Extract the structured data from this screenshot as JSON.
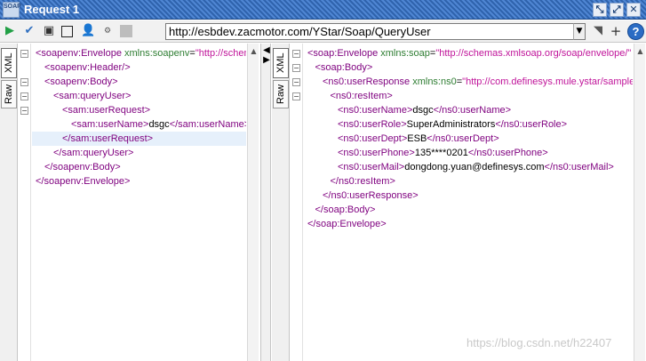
{
  "window": {
    "icon_text": "SOAP",
    "title": "Request 1",
    "buttons": [
      "minimize-restore",
      "maximize",
      "close"
    ]
  },
  "toolbar": {
    "icons": [
      "submit-request-icon",
      "validate-icon",
      "format-icon",
      "stop-icon",
      "user-icon",
      "wsdl-icon",
      "disabled-square-icon"
    ],
    "url": "http://esbdev.zacmotor.com/YStar/Soap/QueryUser",
    "dropdown_glyph": "▼",
    "help_label": "?"
  },
  "request": {
    "tabs": [
      "XML",
      "Raw"
    ],
    "active_tab": "XML",
    "lines": [
      {
        "indent": 0,
        "fold": "−",
        "parts": [
          [
            "t",
            "<soapenv:Envelope"
          ],
          [
            "a",
            " xmlns:soapenv"
          ],
          [
            "txt",
            "="
          ],
          [
            "v",
            "\"http://schemas.xmlsoap.org/soap/envelope/\""
          ]
        ]
      },
      {
        "indent": 1,
        "fold": "",
        "parts": [
          [
            "t",
            "<soapenv:Header/>"
          ]
        ]
      },
      {
        "indent": 1,
        "fold": "−",
        "parts": [
          [
            "t",
            "<soapenv:Body>"
          ]
        ]
      },
      {
        "indent": 2,
        "fold": "−",
        "parts": [
          [
            "t",
            "<sam:queryUser>"
          ]
        ]
      },
      {
        "indent": 3,
        "fold": "−",
        "parts": [
          [
            "t",
            "<sam:userRequest>"
          ]
        ]
      },
      {
        "indent": 4,
        "fold": "",
        "parts": [
          [
            "t",
            "<sam:userName>"
          ],
          [
            "txt",
            "dsgc"
          ],
          [
            "t",
            "</sam:userName>"
          ]
        ]
      },
      {
        "indent": 3,
        "fold": "",
        "highlight": true,
        "parts": [
          [
            "t",
            "</sam:userRequest>"
          ]
        ]
      },
      {
        "indent": 2,
        "fold": "",
        "parts": [
          [
            "t",
            "</sam:queryUser>"
          ]
        ]
      },
      {
        "indent": 1,
        "fold": "",
        "parts": [
          [
            "t",
            "</soapenv:Body>"
          ]
        ]
      },
      {
        "indent": 0,
        "fold": "",
        "parts": [
          [
            "t",
            "</soapenv:Envelope>"
          ]
        ]
      }
    ]
  },
  "response": {
    "tabs": [
      "XML",
      "Raw"
    ],
    "active_tab": "XML",
    "lines": [
      {
        "indent": 0,
        "fold": "−",
        "parts": [
          [
            "t",
            "<soap:Envelope"
          ],
          [
            "a",
            " xmlns:soap"
          ],
          [
            "txt",
            "="
          ],
          [
            "v",
            "\"http://schemas.xmlsoap.org/soap/envelope/\""
          ]
        ]
      },
      {
        "indent": 1,
        "fold": "−",
        "parts": [
          [
            "t",
            "<soap:Body>"
          ]
        ]
      },
      {
        "indent": 2,
        "fold": "−",
        "parts": [
          [
            "t",
            "<ns0:userResponse"
          ],
          [
            "a",
            " xmlns:ns0"
          ],
          [
            "txt",
            "="
          ],
          [
            "v",
            "\"http://com.definesys.mule.ystar/sample\""
          ]
        ]
      },
      {
        "indent": 3,
        "fold": "−",
        "parts": [
          [
            "t",
            "<ns0:resItem>"
          ]
        ]
      },
      {
        "indent": 4,
        "fold": "",
        "parts": [
          [
            "t",
            "<ns0:userName>"
          ],
          [
            "txt",
            "dsgc"
          ],
          [
            "t",
            "</ns0:userName>"
          ]
        ]
      },
      {
        "indent": 4,
        "fold": "",
        "parts": [
          [
            "t",
            "<ns0:userRole>"
          ],
          [
            "txt",
            "SuperAdministrators"
          ],
          [
            "t",
            "</ns0:userRole>"
          ]
        ]
      },
      {
        "indent": 4,
        "fold": "",
        "parts": [
          [
            "t",
            "<ns0:userDept>"
          ],
          [
            "txt",
            "ESB"
          ],
          [
            "t",
            "</ns0:userDept>"
          ]
        ]
      },
      {
        "indent": 4,
        "fold": "",
        "parts": [
          [
            "t",
            "<ns0:userPhone>"
          ],
          [
            "txt",
            "135****0201"
          ],
          [
            "t",
            "</ns0:userPhone>"
          ]
        ]
      },
      {
        "indent": 4,
        "fold": "",
        "parts": [
          [
            "t",
            "<ns0:userMail>"
          ],
          [
            "txt",
            "dongdong.yuan@definesys.com"
          ],
          [
            "t",
            "</ns0:userMail>"
          ]
        ]
      },
      {
        "indent": 3,
        "fold": "",
        "parts": [
          [
            "t",
            "</ns0:resItem>"
          ]
        ]
      },
      {
        "indent": 2,
        "fold": "",
        "parts": [
          [
            "t",
            "</ns0:userResponse>"
          ]
        ]
      },
      {
        "indent": 1,
        "fold": "",
        "parts": [
          [
            "t",
            "</soap:Body>"
          ]
        ]
      },
      {
        "indent": 0,
        "fold": "",
        "parts": [
          [
            "t",
            "</soap:Envelope>"
          ]
        ]
      }
    ]
  },
  "watermark": "https://blog.csdn.net/h22407",
  "colors": {
    "tag": "#7f007f",
    "attribute": "#2e7d32",
    "attribute_value": "#c0149a",
    "titlebar": "#3a72c0"
  }
}
